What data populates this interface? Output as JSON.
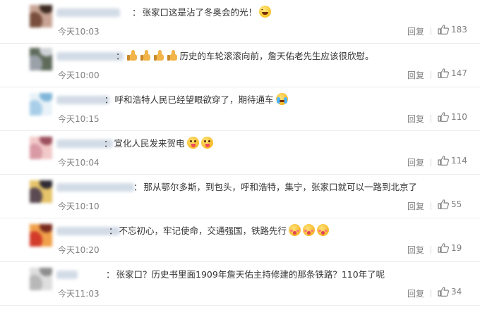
{
  "comments": [
    {
      "text": "张家口这是沾了冬奥会的光！",
      "time": "今天10:03",
      "reply_label": "回复",
      "likes": "183",
      "avatar_colors": [
        "#7a4e3c",
        "#c7a494",
        "#3d2a22"
      ],
      "emojis": [
        "laugh-emoji"
      ],
      "thumbs_before": 0
    },
    {
      "text": "历史的车轮滚滚向前，詹天佑老先生应该很欣慰。",
      "time": "今天10:00",
      "reply_label": "回复",
      "likes": "147",
      "avatar_colors": [
        "#9aa1a8",
        "#5e6a5a",
        "#d0d4d8"
      ],
      "emojis": [],
      "thumbs_before": 4
    },
    {
      "text": "呼和浩特人民已经望眼欲穿了，期待通车",
      "time": "今天10:15",
      "reply_label": "回复",
      "likes": "110",
      "avatar_colors": [
        "#a9cfe8",
        "#e8f2f8",
        "#7fb6d9"
      ],
      "emojis": [
        "cry-emoji"
      ],
      "thumbs_before": 0
    },
    {
      "text": "宣化人民发来贺电",
      "time": "今天10:04",
      "reply_label": "回复",
      "likes": "114",
      "avatar_colors": [
        "#d99aa5",
        "#f2c9c9",
        "#9c4f5c"
      ],
      "emojis": [
        "tongue-emoji",
        "tongue-emoji"
      ],
      "thumbs_before": 0
    },
    {
      "text": "那从鄂尔多斯，到包头，呼和浩特，集宁，张家口就可以一路到北京了",
      "time": "今天10:10",
      "reply_label": "回复",
      "likes": "55",
      "avatar_colors": [
        "#5a4a52",
        "#e6c46a",
        "#2f2a33"
      ],
      "emojis": [],
      "thumbs_before": 0
    },
    {
      "text": "不忘初心，牢记使命，交通强国，铁路先行",
      "time": "今天10:20",
      "reply_label": "回复",
      "likes": "19",
      "avatar_colors": [
        "#d23b2a",
        "#f0a14a",
        "#7a2a1c"
      ],
      "emojis": [
        "blush-emoji",
        "blush-emoji",
        "blush-emoji"
      ],
      "thumbs_before": 0
    },
    {
      "text": "张家口？历史书里面1909年詹天佑主持修建的那条铁路？110年了呢",
      "time": "今天11:03",
      "reply_label": "回复",
      "likes": "34",
      "avatar_colors": [
        "#b8b8b8",
        "#dedede",
        "#8e8e8e"
      ],
      "emojis": [],
      "thumbs_before": 0
    }
  ],
  "colors": {
    "meta_text": "#808080",
    "body_text": "#333333",
    "divider": "#ececec"
  }
}
